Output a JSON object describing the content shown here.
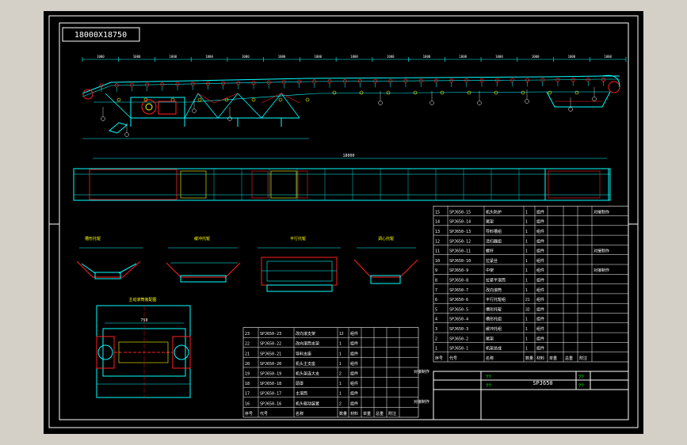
{
  "drawing": {
    "title_stamp": "18000X18750",
    "model_code": "SPJ650",
    "placeholder_marks": [
      "??",
      "??",
      "??",
      "??"
    ],
    "background_color": "#000000",
    "frame_color": "#ffffff",
    "canvas_color": "#d4d0c8",
    "line_colors": {
      "cyan": "#00ffff",
      "red": "#ff2020",
      "yellow": "#ffff00",
      "green": "#00ff00",
      "magenta": "#ff00ff",
      "white": "#ffffff"
    }
  },
  "dimensions": {
    "overall_length": "18000",
    "top_segments": [
      "1000",
      "1000",
      "1000",
      "1000",
      "1000",
      "1000",
      "1000",
      "1000",
      "1000",
      "1000",
      "1000",
      "1000",
      "1000",
      "1000",
      "1000"
    ],
    "plan_width": "750"
  },
  "views": {
    "idler_a": "槽形托辊",
    "idler_b": "缓冲托辊",
    "idler_c": "平行托辊",
    "idler_d": "调心托辊",
    "drum_view": "主动滚筒装配图"
  },
  "bom_right": {
    "rows": [
      {
        "no": "15",
        "code": "SPJ650-15",
        "name": "机头防护",
        "qty": "1",
        "type": "组件",
        "note": "对接制作"
      },
      {
        "no": "14",
        "code": "SPJ650-14",
        "name": "尾架",
        "qty": "1",
        "type": "组件",
        "note": ""
      },
      {
        "no": "13",
        "code": "SPJ650-13",
        "name": "导料槽组",
        "qty": "1",
        "type": "组件",
        "note": ""
      },
      {
        "no": "12",
        "code": "SPJ650-12",
        "name": "清扫器组",
        "qty": "1",
        "type": "组件",
        "note": ""
      },
      {
        "no": "11",
        "code": "SPJ650-11",
        "name": "螺杆",
        "qty": "1",
        "type": "组件",
        "note": "对接制作"
      },
      {
        "no": "10",
        "code": "SPJ650-10",
        "name": "拉紧丝",
        "qty": "1",
        "type": "组件",
        "note": ""
      },
      {
        "no": "9",
        "code": "SPJ650-9",
        "name": "中架",
        "qty": "1",
        "type": "组件",
        "note": "对接制作"
      },
      {
        "no": "8",
        "code": "SPJ650-8",
        "name": "拉紧平滚筒",
        "qty": "1",
        "type": "组件",
        "note": ""
      },
      {
        "no": "7",
        "code": "SPJ650-7",
        "name": "改向滚筒",
        "qty": "1",
        "type": "组件",
        "note": ""
      },
      {
        "no": "6",
        "code": "SPJ650-6",
        "name": "平行托辊组",
        "qty": "21",
        "type": "组件",
        "note": ""
      },
      {
        "no": "5",
        "code": "SPJ650-5",
        "name": "槽形托辊",
        "qty": "32",
        "type": "组件",
        "note": ""
      },
      {
        "no": "4",
        "code": "SPJ650-4",
        "name": "槽形托组",
        "qty": "1",
        "type": "组件",
        "note": ""
      },
      {
        "no": "3",
        "code": "SPJ650-3",
        "name": "缓冲托组",
        "qty": "1",
        "type": "组件",
        "note": ""
      },
      {
        "no": "2",
        "code": "SPJ650-2",
        "name": "尾架",
        "qty": "1",
        "type": "组件",
        "note": ""
      },
      {
        "no": "1",
        "code": "SPJ650-1",
        "name": "机架总成",
        "qty": "1",
        "type": "组件",
        "note": ""
      }
    ],
    "header": [
      "序号",
      "代号",
      "名称",
      "数量",
      "材料",
      "单重",
      "总重",
      "附注"
    ]
  },
  "bom_left": {
    "rows": [
      {
        "no": "23",
        "code": "SPJ650-23",
        "name": "改向滚支架",
        "qty": "12",
        "type": "组件"
      },
      {
        "no": "22",
        "code": "SPJ650-22",
        "name": "改向滚筒支架",
        "qty": "1",
        "type": "组件"
      },
      {
        "no": "21",
        "code": "SPJ650-21",
        "name": "导料支座",
        "qty": "1",
        "type": "组件"
      },
      {
        "no": "20",
        "code": "SPJ650-20",
        "name": "机头主支座",
        "qty": "1",
        "type": "组件"
      },
      {
        "no": "19",
        "code": "SPJ650-19",
        "name": "机头架连大支",
        "qty": "2",
        "type": "组件"
      },
      {
        "no": "18",
        "code": "SPJ650-18",
        "name": "頭罩",
        "qty": "1",
        "type": "组件"
      },
      {
        "no": "17",
        "code": "SPJ650-17",
        "name": "主滚筒",
        "qty": "1",
        "type": "组件"
      },
      {
        "no": "16",
        "code": "SPJ650-16",
        "name": "机头驱动装置",
        "qty": "2",
        "type": "组件"
      }
    ],
    "header": [
      "序号",
      "代号",
      "名称",
      "数量",
      "材料",
      "单重",
      "总重",
      "附注"
    ],
    "note_a": "对接制作",
    "note_b": "对接制作"
  }
}
